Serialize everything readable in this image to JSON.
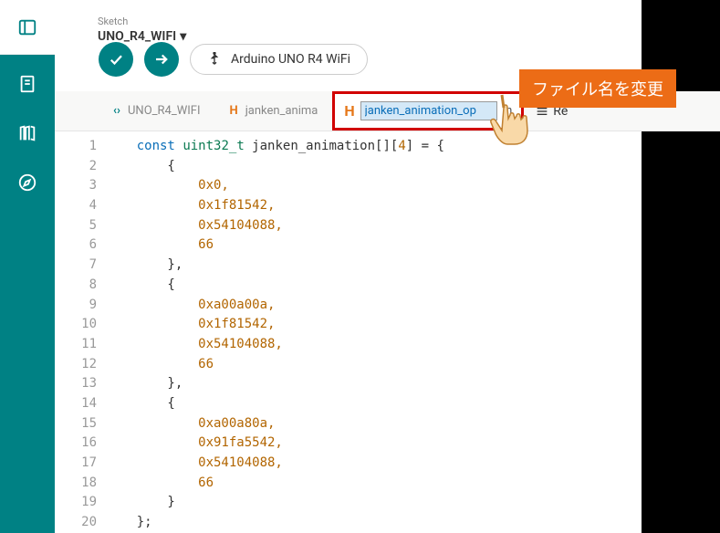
{
  "header": {
    "sketch_label": "Sketch",
    "board_name": "UNO_R4_WIFI"
  },
  "toolbar": {
    "board_pill": "Arduino UNO R4 WiFi"
  },
  "tabs": {
    "main": "UNO_R4_WIFI",
    "h1": "janken_anima",
    "rename_value": "janken_animation_op",
    "rename_ext": ".h",
    "right_text": "Re"
  },
  "annotation": "ファイル名を変更",
  "code": {
    "lines": [
      "1",
      "2",
      "3",
      "4",
      "5",
      "6",
      "7",
      "8",
      "9",
      "10",
      "11",
      "12",
      "13",
      "14",
      "15",
      "16",
      "17",
      "18",
      "19",
      "20"
    ],
    "l1_a": "const",
    "l1_b": "uint32_t",
    "l1_c": " janken_animation[][",
    "l1_d": "4",
    "l1_e": "] = {",
    "l2": "        {",
    "l3": "            0x0,",
    "l4": "            0x1f81542,",
    "l5": "            0x54104088,",
    "l6": "            66",
    "l7": "        },",
    "l8": "        {",
    "l9": "            0xa00a00a,",
    "l10": "            0x1f81542,",
    "l11": "            0x54104088,",
    "l12": "            66",
    "l13": "        },",
    "l14": "        {",
    "l15": "            0xa00a80a,",
    "l16": "            0x91fa5542,",
    "l17": "            0x54104088,",
    "l18": "            66",
    "l19": "        }",
    "l20": "    };"
  }
}
